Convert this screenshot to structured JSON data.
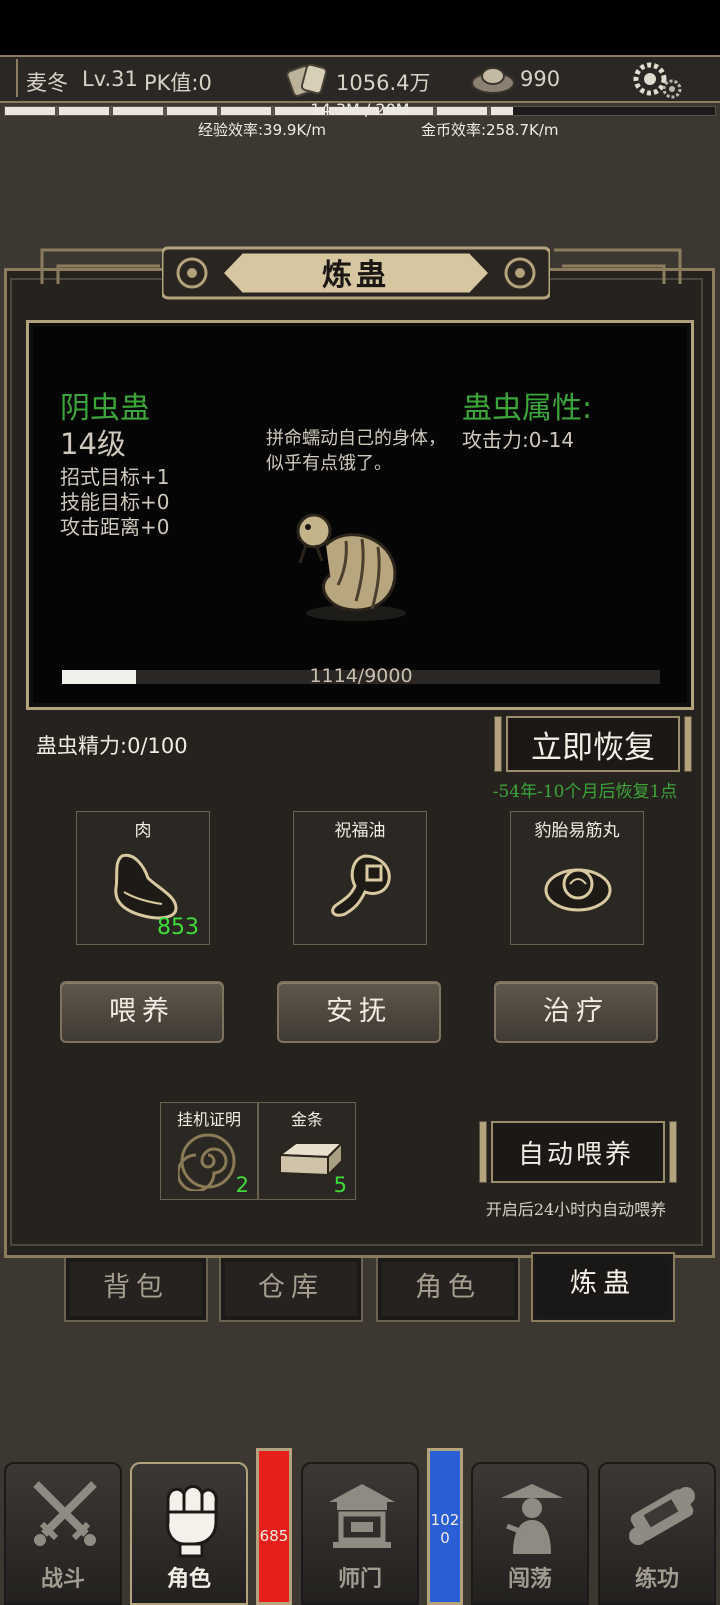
{
  "header": {
    "player_name": "麦冬",
    "level": "Lv.31",
    "pk": "PK值:0",
    "copper": "1056.4万",
    "gold": "990",
    "exp_progress_text": "14.3M / 20M",
    "exp_progress": 0.715,
    "exp_rate": "经验效率:39.9K/m",
    "gold_rate": "金币效率:258.7K/m"
  },
  "panel": {
    "title": "炼蛊",
    "gu_name": "阴虫蛊",
    "gu_level": "14级",
    "stats": [
      "招式目标+1",
      "技能目标+0",
      "攻击距离+0"
    ],
    "description": "拼命蠕动自己的身体，似乎有点饿了。",
    "attr_title": "蛊虫属性:",
    "attr_value": "攻击力:0-14",
    "progress_text": "1114/9000",
    "progress": 0.124
  },
  "energy": {
    "label": "蛊虫精力:0/100",
    "restore_button": "立即恢复",
    "restore_hint": "-54年-10个月后恢复1点"
  },
  "items": [
    {
      "name": "肉",
      "count": "853",
      "icon": "meat-icon"
    },
    {
      "name": "祝福油",
      "count": "",
      "icon": "oil-gourd-icon"
    },
    {
      "name": "豹胎易筋丸",
      "count": "",
      "icon": "pill-bowl-icon"
    }
  ],
  "actions": [
    "喂养",
    "安抚",
    "治疗"
  ],
  "auto_items": [
    {
      "name": "挂机证明",
      "count": "2",
      "icon": "spiral-token-icon"
    },
    {
      "name": "金条",
      "count": "5",
      "icon": "gold-bar-icon"
    }
  ],
  "auto_feed": {
    "button": "自动喂养",
    "hint": "开启后24小时内自动喂养"
  },
  "subtabs": [
    "背包",
    "仓库",
    "角色",
    "炼蛊"
  ],
  "active_subtab": "炼蛊",
  "nav": {
    "items": [
      {
        "label": "战斗",
        "icon": "crossed-swords-icon"
      },
      {
        "label": "角色",
        "icon": "fist-icon"
      },
      {
        "label": "师门",
        "icon": "temple-icon"
      },
      {
        "label": "闯荡",
        "icon": "wanderer-icon"
      },
      {
        "label": "练功",
        "icon": "scroll-icon"
      }
    ],
    "active": "角色",
    "hp_value": "685",
    "mp_value": "1020"
  },
  "colors": {
    "accent_gold": "#b3a37c",
    "green": "#3ca53a",
    "hp_red": "#e8201c",
    "mp_blue": "#2a5fd6"
  }
}
